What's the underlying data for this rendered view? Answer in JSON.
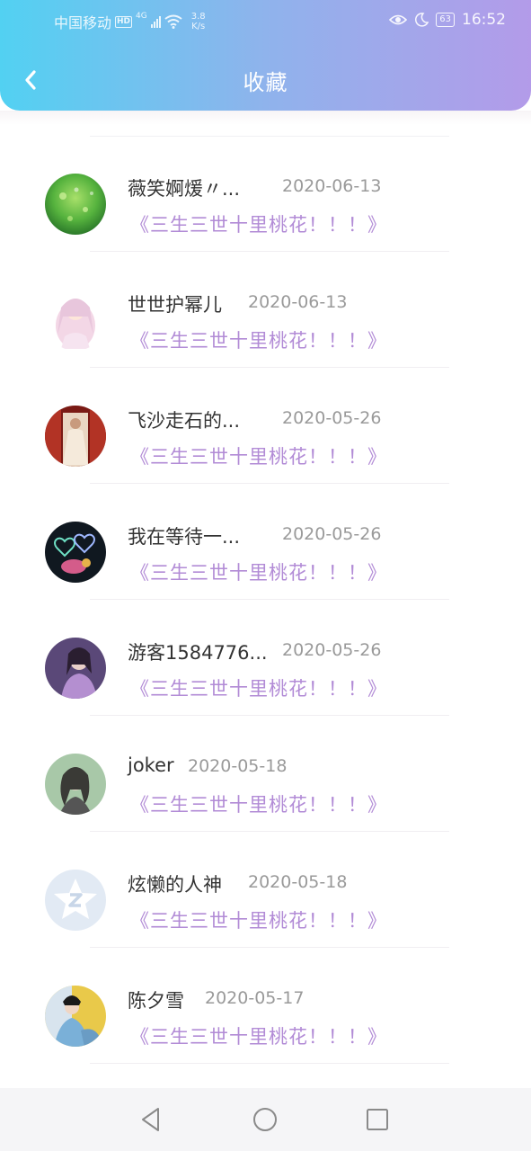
{
  "status_bar": {
    "carrier": "中国移动",
    "hd": "HD",
    "network": "4G",
    "speed_value": "3.8",
    "speed_unit": "K/s",
    "battery": "63",
    "time": "16:52"
  },
  "header": {
    "title": "收藏"
  },
  "favorites": [
    {
      "name": "薇笑婀煖〃...",
      "date": "2020-06-13",
      "book": "《三生三世十里桃花！！！》",
      "avatar": "green-bokeh"
    },
    {
      "name": "世世护幂儿",
      "date": "2020-06-13",
      "book": "《三生三世十里桃花！！！》",
      "avatar": "anime-girl"
    },
    {
      "name": "飞沙走石的...",
      "date": "2020-05-26",
      "book": "《三生三世十里桃花！！！》",
      "avatar": "woman-curtains"
    },
    {
      "name": "我在等待一...",
      "date": "2020-05-26",
      "book": "《三生三世十里桃花！！！》",
      "avatar": "hearts-dark"
    },
    {
      "name": "游客1584776...",
      "date": "2020-05-26",
      "book": "《三生三世十里桃花！！！》",
      "avatar": "purple-portrait"
    },
    {
      "name": "joker",
      "date": "2020-05-18",
      "book": "《三生三世十里桃花！！！》",
      "avatar": "girl-sketch"
    },
    {
      "name": "炫懒的人神",
      "date": "2020-05-18",
      "book": "《三生三世十里桃花！！！》",
      "avatar": "qq-default"
    },
    {
      "name": "陈夕雪",
      "date": "2020-05-17",
      "book": "《三生三世十里桃花！！！》",
      "avatar": "costume-drama"
    }
  ],
  "nav_bar": {
    "back": "triangle-back-icon",
    "home": "circle-home-icon",
    "recents": "square-recents-icon"
  }
}
